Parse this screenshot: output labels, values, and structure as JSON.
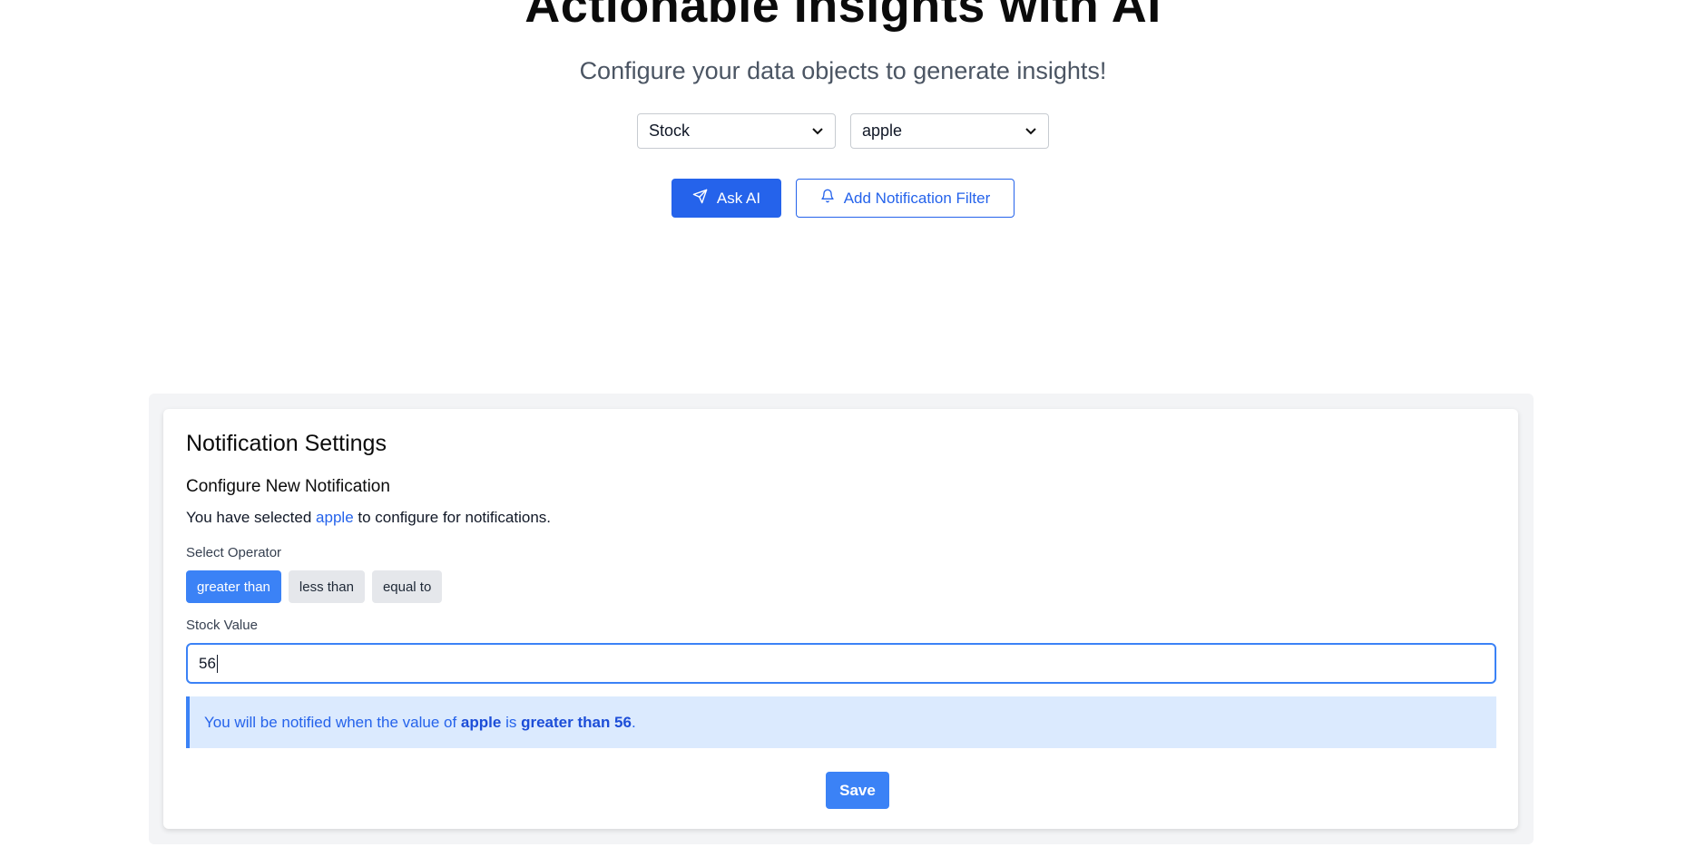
{
  "hero": {
    "title": "Actionable Insights with AI",
    "subtitle": "Configure your data objects to generate insights!"
  },
  "selects": {
    "type_value": "Stock",
    "item_value": "apple"
  },
  "actions": {
    "ask_ai_label": "Ask AI",
    "ask_ai_icon": "send-icon",
    "add_filter_label": "Add Notification Filter",
    "add_filter_icon": "bell-icon"
  },
  "notification_settings": {
    "title": "Notification Settings",
    "configure_title": "Configure New Notification",
    "selected_prefix": "You have selected ",
    "selected_item": "apple",
    "selected_suffix": " to configure for notifications.",
    "operator_label": "Select Operator",
    "operators": [
      {
        "label": "greater than",
        "active": true
      },
      {
        "label": "less than",
        "active": false
      },
      {
        "label": "equal to",
        "active": false
      }
    ],
    "value_label": "Stock Value",
    "value": "56",
    "info": {
      "prefix": "You will be notified when the value of ",
      "item": "apple",
      "middle": " is ",
      "condition": "greater than 56",
      "suffix": "."
    },
    "save_label": "Save"
  },
  "colors": {
    "primary": "#2563eb",
    "accent": "#3b82f6",
    "info_bg": "#dbeafe",
    "panel_bg": "#f3f4f6"
  }
}
